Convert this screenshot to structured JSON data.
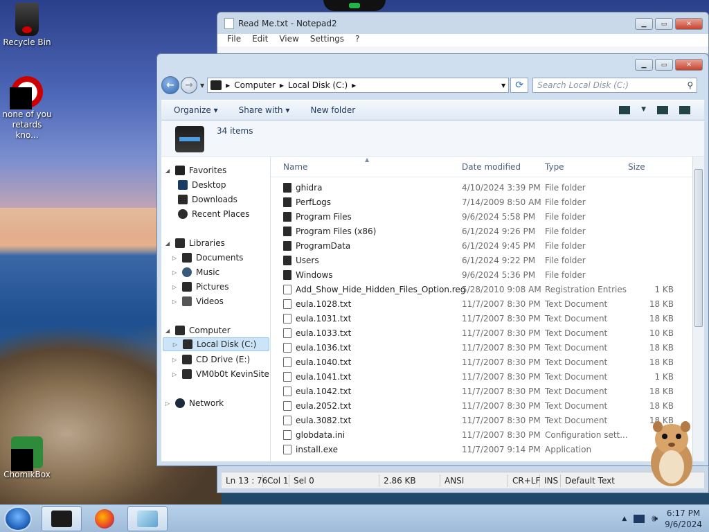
{
  "desktop": {
    "icons": [
      {
        "label": "Recycle Bin"
      },
      {
        "label": "none of you retards kno..."
      },
      {
        "label": "ChomikBox"
      }
    ]
  },
  "notepad": {
    "title": "Read Me.txt - Notepad2",
    "menu": [
      "File",
      "Edit",
      "View",
      "Settings",
      "?"
    ],
    "status": {
      "position": "Ln 13 : 76",
      "col": "Col 1",
      "sel": "Sel 0",
      "size": "2.86 KB",
      "encoding": "ANSI",
      "eol": "CR+LF",
      "mode": "INS",
      "scheme": "Default Text"
    }
  },
  "explorer": {
    "breadcrumb": [
      "Computer",
      "Local Disk (C:)"
    ],
    "search_placeholder": "Search Local Disk (C:)",
    "commands": [
      "Organize",
      "Share with",
      "New folder"
    ],
    "item_count": "34 items",
    "columns": {
      "name": "Name",
      "date": "Date modified",
      "type": "Type",
      "size": "Size"
    },
    "nav": {
      "favorites": "Favorites",
      "desktop": "Desktop",
      "downloads": "Downloads",
      "recent": "Recent Places",
      "libraries": "Libraries",
      "documents": "Documents",
      "music": "Music",
      "pictures": "Pictures",
      "videos": "Videos",
      "computer": "Computer",
      "local_disk": "Local Disk (C:)",
      "cd_drive": "CD Drive (E:)",
      "vm": "VM0b0t KevinSite",
      "network": "Network"
    },
    "files": [
      {
        "name": "ghidra",
        "date": "4/10/2024 3:39 PM",
        "type": "File folder",
        "size": ""
      },
      {
        "name": "PerfLogs",
        "date": "7/14/2009 8:50 AM",
        "type": "File folder",
        "size": ""
      },
      {
        "name": "Program Files",
        "date": "9/6/2024 5:58 PM",
        "type": "File folder",
        "size": ""
      },
      {
        "name": "Program Files (x86)",
        "date": "6/1/2024 9:26 PM",
        "type": "File folder",
        "size": ""
      },
      {
        "name": "ProgramData",
        "date": "6/1/2024 9:45 PM",
        "type": "File folder",
        "size": ""
      },
      {
        "name": "Users",
        "date": "6/1/2024 9:22 PM",
        "type": "File folder",
        "size": ""
      },
      {
        "name": "Windows",
        "date": "9/6/2024 5:36 PM",
        "type": "File folder",
        "size": ""
      },
      {
        "name": "Add_Show_Hide_Hidden_Files_Option.reg",
        "date": "5/28/2010 9:08 AM",
        "type": "Registration Entries",
        "size": "1 KB"
      },
      {
        "name": "eula.1028.txt",
        "date": "11/7/2007 8:30 PM",
        "type": "Text Document",
        "size": "18 KB"
      },
      {
        "name": "eula.1031.txt",
        "date": "11/7/2007 8:30 PM",
        "type": "Text Document",
        "size": "18 KB"
      },
      {
        "name": "eula.1033.txt",
        "date": "11/7/2007 8:30 PM",
        "type": "Text Document",
        "size": "10 KB"
      },
      {
        "name": "eula.1036.txt",
        "date": "11/7/2007 8:30 PM",
        "type": "Text Document",
        "size": "18 KB"
      },
      {
        "name": "eula.1040.txt",
        "date": "11/7/2007 8:30 PM",
        "type": "Text Document",
        "size": "18 KB"
      },
      {
        "name": "eula.1041.txt",
        "date": "11/7/2007 8:30 PM",
        "type": "Text Document",
        "size": "1 KB"
      },
      {
        "name": "eula.1042.txt",
        "date": "11/7/2007 8:30 PM",
        "type": "Text Document",
        "size": "18 KB"
      },
      {
        "name": "eula.2052.txt",
        "date": "11/7/2007 8:30 PM",
        "type": "Text Document",
        "size": "18 KB"
      },
      {
        "name": "eula.3082.txt",
        "date": "11/7/2007 8:30 PM",
        "type": "Text Document",
        "size": "18 KB"
      },
      {
        "name": "globdata.ini",
        "date": "11/7/2007 8:30 PM",
        "type": "Configuration sett...",
        "size": ""
      },
      {
        "name": "install.exe",
        "date": "11/7/2007 9:14 PM",
        "type": "Application",
        "size": "8"
      }
    ]
  },
  "taskbar": {
    "time": "6:17 PM",
    "date": "9/6/2024"
  }
}
